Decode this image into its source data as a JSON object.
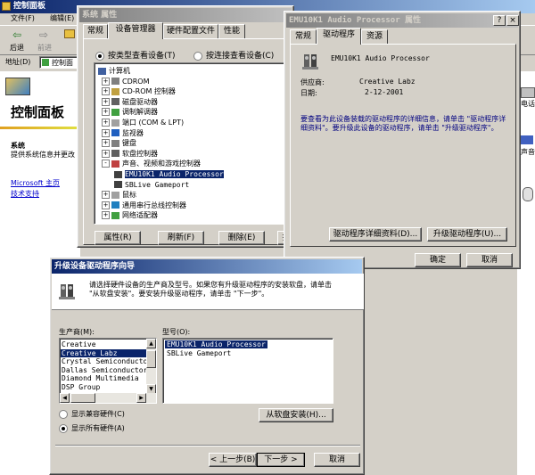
{
  "control_panel": {
    "title": "控制面板",
    "menu": [
      "文件(F)",
      "编辑(E)"
    ],
    "toolbar": {
      "back": "后退",
      "forward": "前进"
    },
    "address_label": "地址(D)",
    "address_value": "控制面",
    "heading": "控制面板",
    "section_title": "系统",
    "section_desc": "提供系统信息并更改",
    "links": [
      "Microsoft 主页",
      "技术支持"
    ],
    "right_labels": [
      "电话",
      "声音"
    ]
  },
  "system_props": {
    "title": "系统 属性",
    "tabs": [
      "常规",
      "设备管理器",
      "硬件配置文件",
      "性能"
    ],
    "radio_by_type": "按类型查看设备(T)",
    "radio_by_conn": "按连接查看设备(C)",
    "tree": [
      {
        "label": "计算机",
        "pm": ""
      },
      {
        "label": "CDROM",
        "pm": "+"
      },
      {
        "label": "CD-ROM 控制器",
        "pm": "+"
      },
      {
        "label": "磁盘驱动器",
        "pm": "+"
      },
      {
        "label": "调制解调器",
        "pm": "+"
      },
      {
        "label": "端口 (COM & LPT)",
        "pm": "+"
      },
      {
        "label": "监视器",
        "pm": "+"
      },
      {
        "label": "键盘",
        "pm": "+"
      },
      {
        "label": "软盘控制器",
        "pm": "+"
      },
      {
        "label": "声音、视频和游戏控制器",
        "pm": "-"
      },
      {
        "label": "EMU10K1 Audio Processor",
        "pm": "",
        "child": true,
        "selected": true
      },
      {
        "label": "SBLive Gameport",
        "pm": "",
        "child": true
      },
      {
        "label": "鼠标",
        "pm": "+"
      },
      {
        "label": "通用串行总线控制器",
        "pm": "+"
      },
      {
        "label": "网络适配器",
        "pm": "+"
      }
    ],
    "buttons": [
      "属性(R)",
      "刷新(F)",
      "删除(E)",
      "打"
    ]
  },
  "emu_props": {
    "title": "EMU10K1 Audio Processor 属性",
    "tabs": [
      "常规",
      "驱动程序",
      "资源"
    ],
    "device_name": "EMU10K1 Audio Processor",
    "provider_label": "供应商:",
    "provider_value": "Creative Labz",
    "date_label": "日期:",
    "date_value": "2-12-2001",
    "description": "要查看为此设备装载的驱动程序的详细信息，请单击 \"驱动程序详细资料\"。要升级此设备的驱动程序，请单击 \"升级驱动程序\"。",
    "btn_details": "驱动程序详细资料(D)...",
    "btn_upgrade": "升级驱动程序(U)...",
    "btn_ok": "确定",
    "btn_cancel": "取消"
  },
  "wizard": {
    "title": "升级设备驱动程序向导",
    "instructions": "请选择硬件设备的生产商及型号。如果您有升级驱动程序的安装软盘，请单击 \"从软盘安装\"。要安装升级驱动程序，请单击 \"下一步\"。",
    "manufacturer_label": "生产商(M):",
    "manufacturers": [
      "Creative",
      "Creative Labz",
      "Crystal Semiconductor",
      "Dallas Semiconductor",
      "Diamond Multimedia",
      "DSP Group"
    ],
    "selected_manufacturer_index": 1,
    "model_label": "型号(O):",
    "models": [
      "EMU10K1 Audio Processor",
      "SBLive Gameport"
    ],
    "radio_compatible": "显示兼容硬件(C)",
    "radio_all": "显示所有硬件(A)",
    "btn_have_disk": "从软盘安装(H)...",
    "btn_back": "< 上一步(B)",
    "btn_next": "下一步 >",
    "btn_cancel": "取消"
  },
  "colors": {
    "titlebar_active": "#0a246a",
    "selection": "#0a246a",
    "face": "#d4d0c8"
  }
}
